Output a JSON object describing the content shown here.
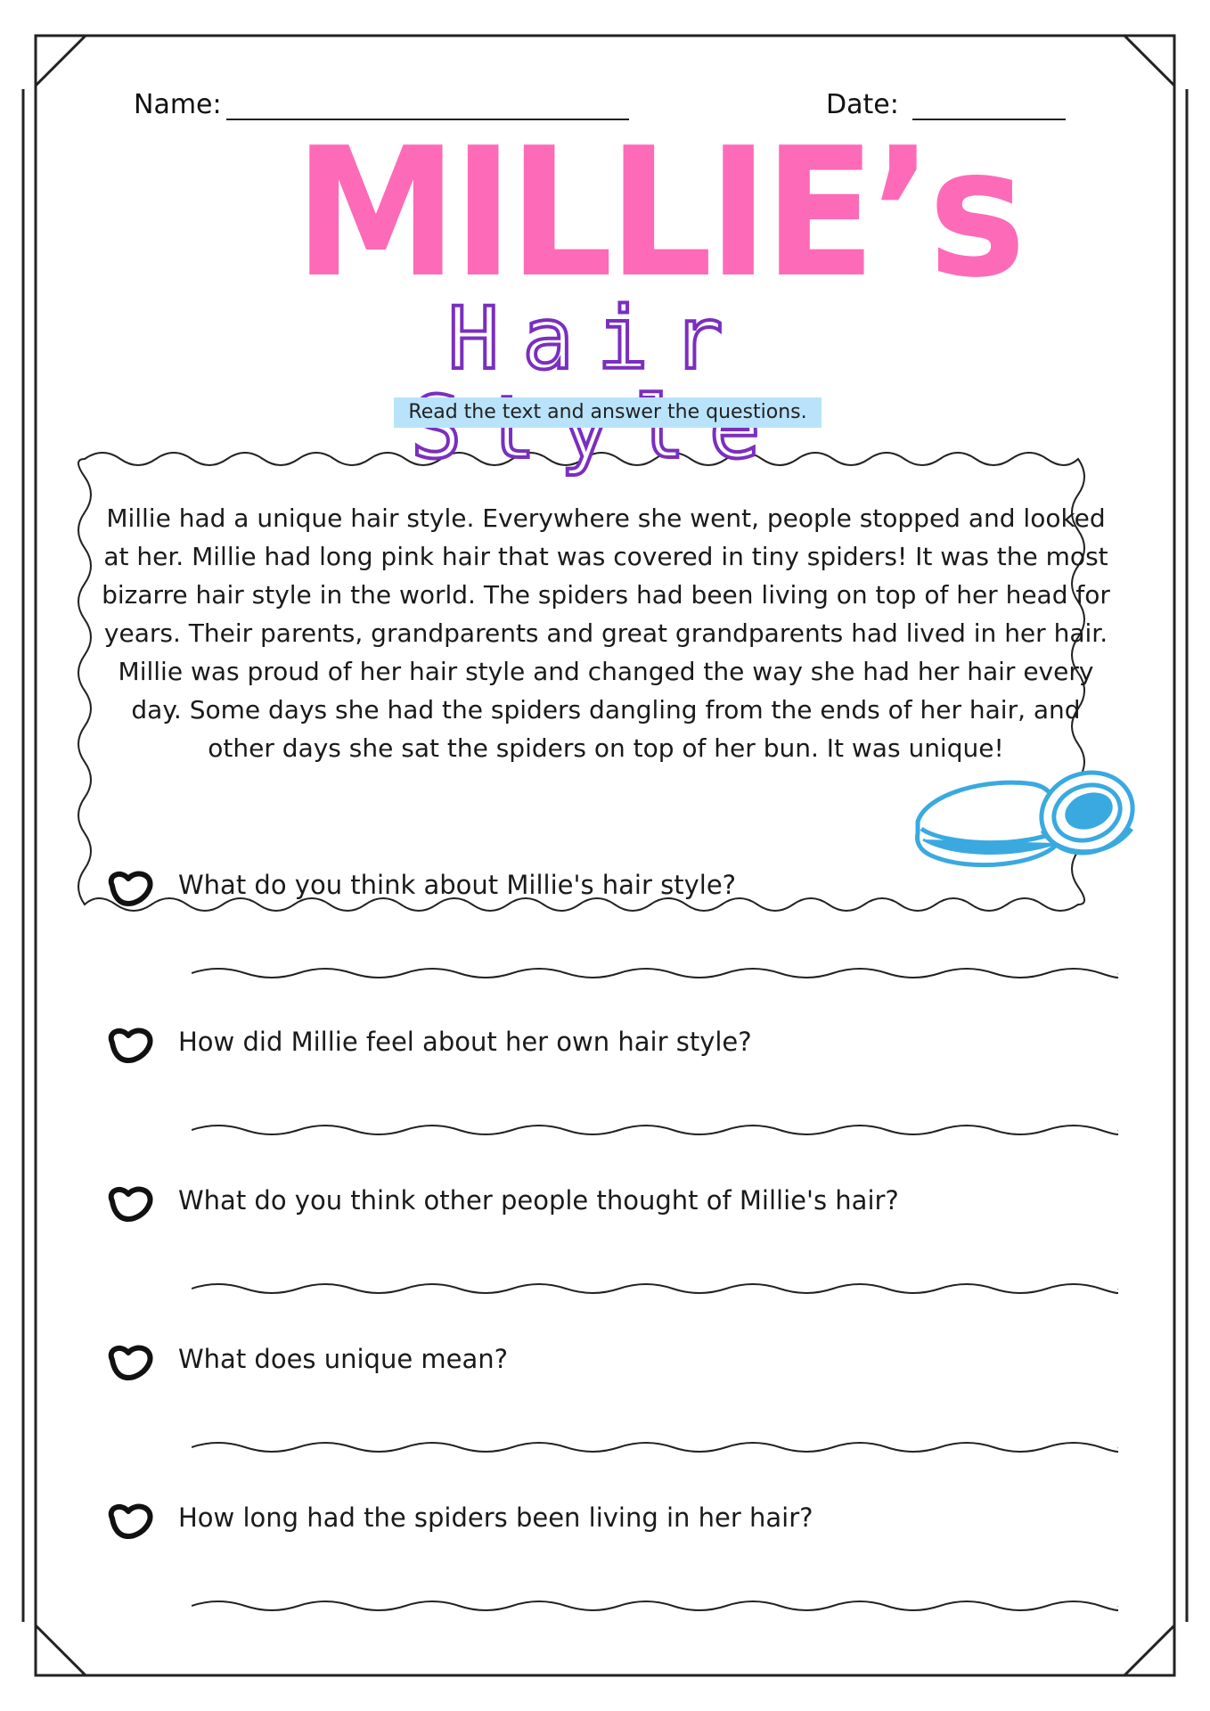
{
  "header": {
    "name_label": "Name:",
    "date_label": "Date:"
  },
  "title": {
    "main": "MILLIE’s",
    "sub": "Hair Style"
  },
  "instruction": "Read the text and answer the questions.",
  "passage": "Millie had a unique hair style. Everywhere she went, people stopped and looked at her. Millie had long pink hair that was covered in tiny spiders! It was the most bizarre hair style in the world. The spiders had been living on top of her head for years. Their parents, grandparents and great grandparents had lived in her hair. Millie was proud of her hair style and changed the way she had her hair every day. Some days she had the spiders dangling from the ends of her hair, and other days she sat the spiders on top of her bun. It was unique!",
  "questions": [
    {
      "text": "What do you think about Millie's hair style?"
    },
    {
      "text": "How did Millie feel about her own hair style?"
    },
    {
      "text": "What do you think other people thought of Millie's hair?"
    },
    {
      "text": "What does unique mean?"
    },
    {
      "text": "How long had the spiders been living in her hair?"
    }
  ],
  "colors": {
    "title_pink": "#fd6ab8",
    "subtitle_purple": "#7a2fbf",
    "instruction_bg": "#b9e3fa",
    "pomade_blue": "#3aa9e0"
  },
  "icons": {
    "question_marker": "heart-outline-icon",
    "illustration": "hair-pomade-tin"
  }
}
